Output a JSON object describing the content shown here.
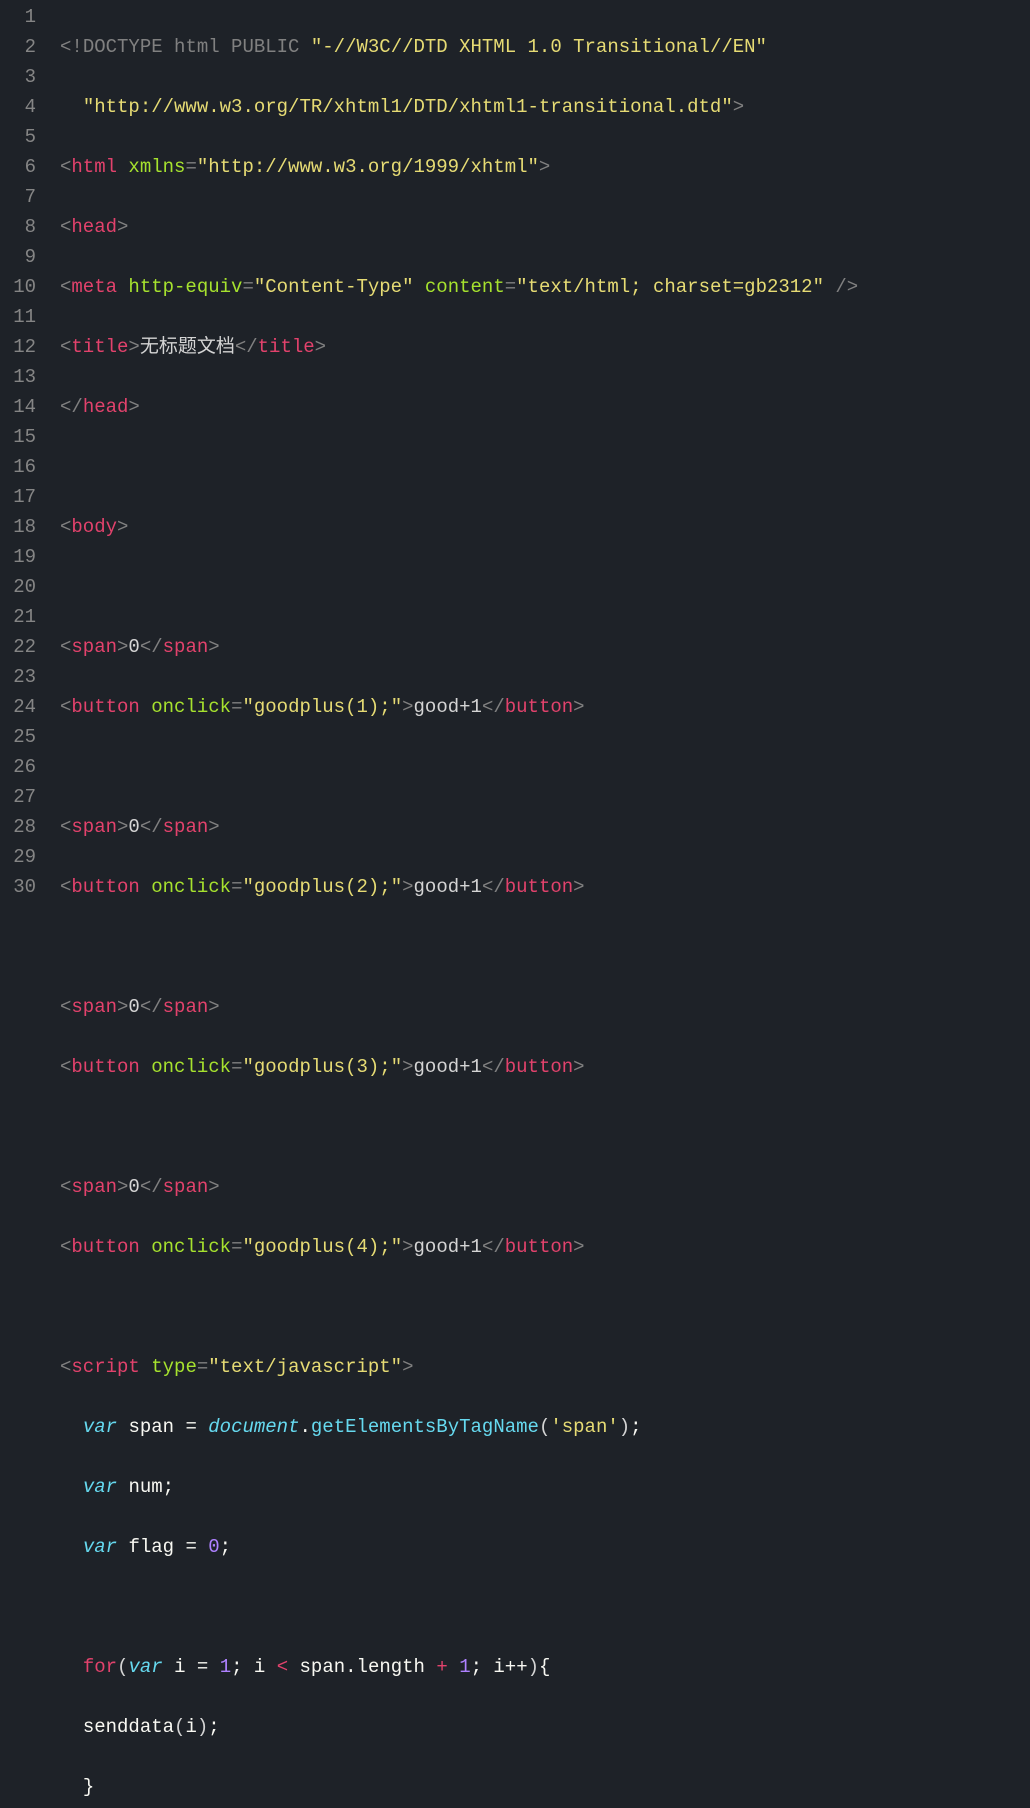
{
  "gutter": [
    "1",
    "2",
    "3",
    "4",
    "5",
    "6",
    "7",
    "8",
    "9",
    "10",
    "11",
    "12",
    "13",
    "14",
    "15",
    "16",
    "17",
    "18",
    "19",
    "20",
    "21",
    "22",
    "23",
    "24",
    "25",
    "26",
    "27",
    "28",
    "29",
    "30"
  ],
  "tokens": {
    "doctype_open": "<!",
    "doctype_word": "DOCTYPE",
    "doctype_rest1": " html PUBLIC ",
    "doctype_str1": "\"-//W3C//DTD XHTML 1.0 Transitional//EN\"",
    "doctype_rest2": "  ",
    "doctype_str2": "\"http://www.w3.org/TR/xhtml1/DTD/xhtml1-transitional.dtd\"",
    "gt": ">",
    "lt": "<",
    "slash": "/",
    "tag_html": "html",
    "attr_xmlns": "xmlns",
    "eq": "=",
    "val_xmlns": "\"http://www.w3.org/1999/xhtml\"",
    "tag_head": "head",
    "tag_meta": "meta",
    "attr_httpequiv": "http-equiv",
    "val_contenttype": "\"Content-Type\"",
    "attr_content": "content",
    "val_charset": "\"text/html; charset=gb2312\"",
    "selfclose": " />",
    "tag_title": "title",
    "title_text": "无标题文档",
    "tag_body": "body",
    "tag_span": "span",
    "span_text": "0",
    "tag_button": "button",
    "attr_onclick": "onclick",
    "val_onclick1": "\"goodplus(1);\"",
    "val_onclick2": "\"goodplus(2);\"",
    "val_onclick3": "\"goodplus(3);\"",
    "val_onclick4": "\"goodplus(4);\"",
    "button_text": "good+1",
    "tag_script": "script",
    "attr_type": "type",
    "val_script": "\"text/javascript\"",
    "kw_var": "var",
    "var_span": "span",
    "op_eq": " = ",
    "doc": "document",
    "dot": ".",
    "getbytag": "getElementsByTagName",
    "str_span": "'span'",
    "semi": ";",
    "var_num": "num",
    "var_flag": "flag",
    "num_0": "0",
    "kw_for": "for",
    "var_i": "i",
    "num_1": "1",
    "op_lt": " < ",
    "len": "length",
    "op_plus": " + ",
    "inc": "i++",
    "lbrace": "{",
    "rbrace": "}",
    "senddata": "senddata",
    "indent1": "  ",
    "indent2": "  "
  }
}
